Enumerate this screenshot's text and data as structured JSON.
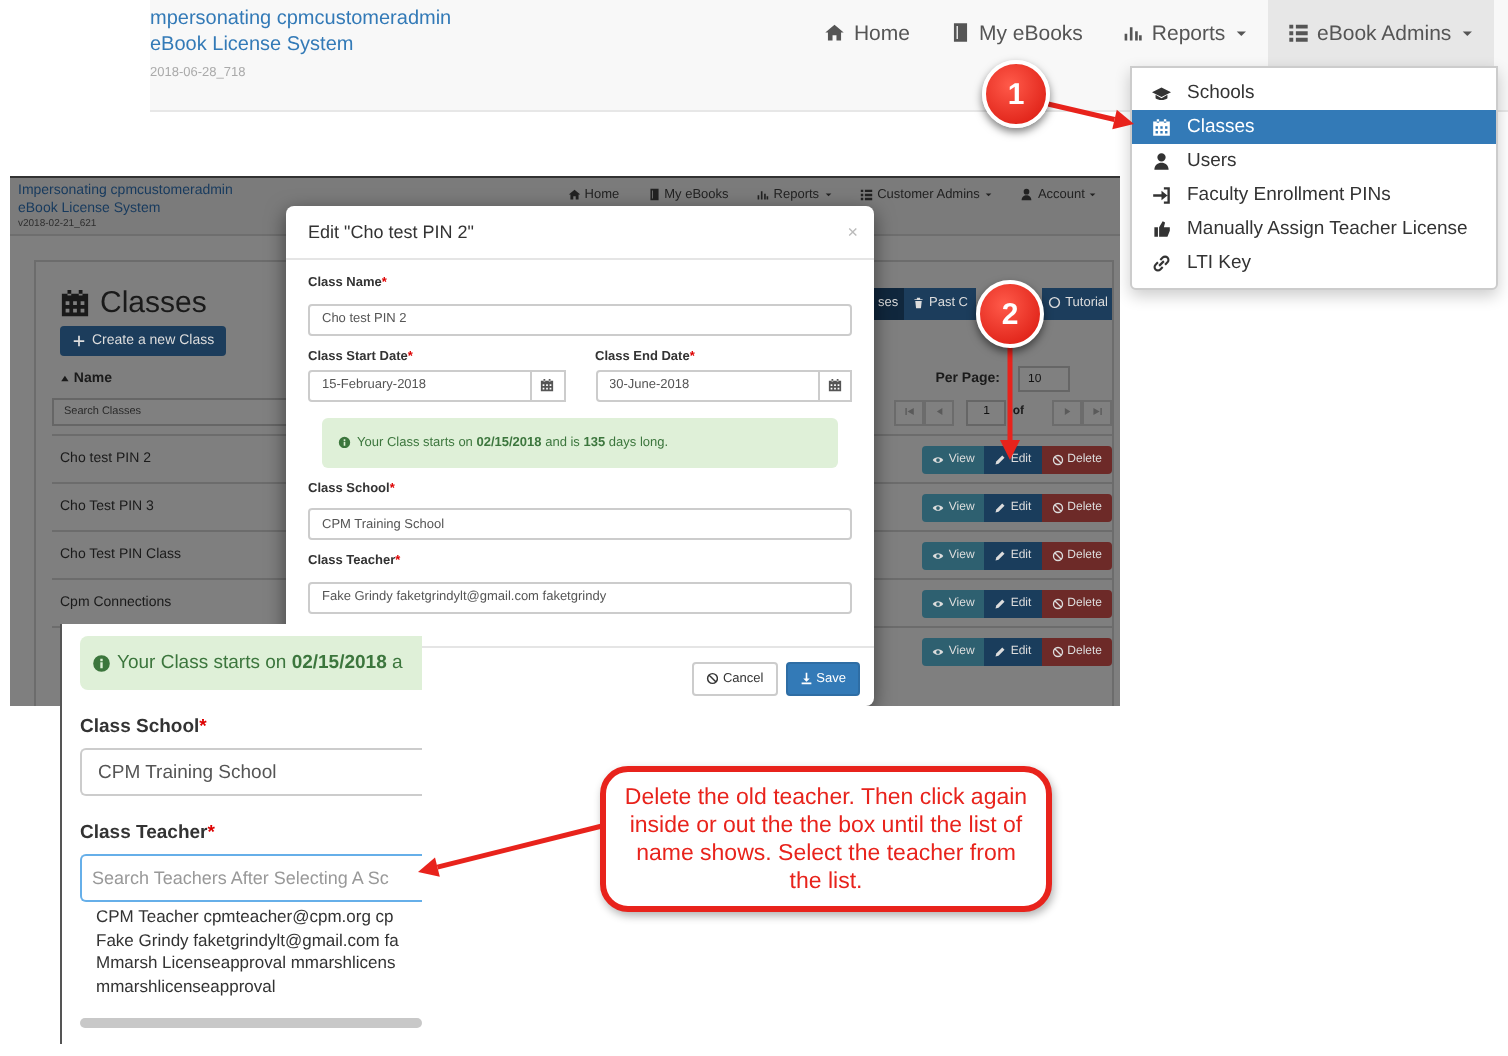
{
  "top_screenshot": {
    "header_lines": [
      "mpersonating cpmcustomeradmin",
      "eBook License System"
    ],
    "version": "2018-06-28_718",
    "nav": [
      {
        "label": "Home",
        "dropdown": false,
        "open": false
      },
      {
        "label": "My eBooks",
        "dropdown": false,
        "open": false
      },
      {
        "label": "Reports",
        "dropdown": true,
        "open": false
      },
      {
        "label": "eBook Admins",
        "dropdown": true,
        "open": true
      }
    ],
    "menu": [
      {
        "label": "Schools",
        "selected": false
      },
      {
        "label": "Classes",
        "selected": true
      },
      {
        "label": "Users",
        "selected": false
      },
      {
        "label": "Faculty Enrollment PINs",
        "selected": false
      },
      {
        "label": "Manually Assign Teacher License",
        "selected": false
      },
      {
        "label": "LTI Key",
        "selected": false
      }
    ]
  },
  "background_screenshot": {
    "header_lines": [
      "Impersonating cpmcustomeradmin",
      "eBook License System"
    ],
    "version": "v2018-02-21_621",
    "nav": [
      {
        "label": "Home",
        "dropdown": false
      },
      {
        "label": "My eBooks",
        "dropdown": false
      },
      {
        "label": "Reports",
        "dropdown": true
      },
      {
        "label": "Customer Admins",
        "dropdown": true
      },
      {
        "label": "Account",
        "dropdown": true
      }
    ],
    "page_title": "Classes",
    "create_button": "Create a new Class",
    "toolbar": [
      {
        "label": "ses",
        "selected": true
      },
      {
        "label": "Past C",
        "selected": false
      },
      {
        "label": "Tutorial",
        "selected": false
      }
    ],
    "name_column": "Name",
    "per_page_label": "Per Page:",
    "per_page": "10",
    "search_placeholder": "Search Classes",
    "pager": {
      "page": "1",
      "of": "of"
    },
    "rows": [
      {
        "name": "Cho test PIN 2",
        "actions": [
          {
            "label": "View",
            "kind": "view"
          },
          {
            "label": "Edit",
            "kind": "edit"
          },
          {
            "label": "Delete",
            "kind": "delete"
          }
        ]
      },
      {
        "name": "Cho Test PIN 3",
        "actions": [
          {
            "label": "View",
            "kind": "view"
          },
          {
            "label": "Edit",
            "kind": "edit"
          },
          {
            "label": "Delete",
            "kind": "delete"
          }
        ]
      },
      {
        "name": "Cho Test PIN Class",
        "actions": [
          {
            "label": "View",
            "kind": "view"
          },
          {
            "label": "Edit",
            "kind": "edit"
          },
          {
            "label": "Delete",
            "kind": "delete"
          }
        ]
      },
      {
        "name": "Cpm Connections",
        "actions": [
          {
            "label": "View",
            "kind": "view"
          },
          {
            "label": "Edit",
            "kind": "edit"
          },
          {
            "label": "Delete",
            "kind": "delete"
          }
        ]
      },
      {
        "actions": [
          {
            "label": "View",
            "kind": "view"
          },
          {
            "label": "Edit",
            "kind": "edit"
          },
          {
            "label": "Delete",
            "kind": "delete"
          }
        ]
      }
    ],
    "modal": {
      "title": "Edit \"Cho test PIN 2\"",
      "close": "×",
      "class_name": {
        "label": "Class Name",
        "mark": "*",
        "value": "Cho test PIN 2"
      },
      "start_date": {
        "label": "Class Start Date",
        "mark": "*",
        "value": "15-February-2018"
      },
      "end_date": {
        "label": "Class End Date",
        "mark": "*",
        "value": "30-June-2018"
      },
      "notice": "Your Class starts on **02/15/2018** and is **135** days long.",
      "class_school": {
        "label": "Class School",
        "mark": "*",
        "value": "CPM Training School"
      },
      "class_teacher": {
        "label": "Class Teacher",
        "mark": "*",
        "value": "Fake Grindy faketgrindylt@gmail.com faketgrindy"
      },
      "buttons": [
        {
          "label": "Cancel",
          "kind": "cancel"
        },
        {
          "label": "Save",
          "kind": "save"
        }
      ]
    }
  },
  "inset": {
    "notice": "Your Class starts on **02/15/2018** a",
    "class_school": {
      "label": "Class School",
      "mark": "*",
      "value": "CPM Training School"
    },
    "class_teacher": {
      "label": "Class Teacher",
      "mark": "*",
      "placeholder": "Search Teachers After Selecting A Sc"
    },
    "options": [
      "CPM Teacher cpmteacher@cpm.org cp",
      "Fake Grindy faketgrindylt@gmail.com fa",
      "Mmarsh Licenseapproval mmarshlicens",
      "mmarshlicenseapproval"
    ]
  },
  "callout": "Delete the old teacher. Then click again inside or out the the box until the list of name shows. Select the teacher from the list.",
  "steps": [
    {
      "label": "1"
    },
    {
      "label": "2"
    }
  ]
}
